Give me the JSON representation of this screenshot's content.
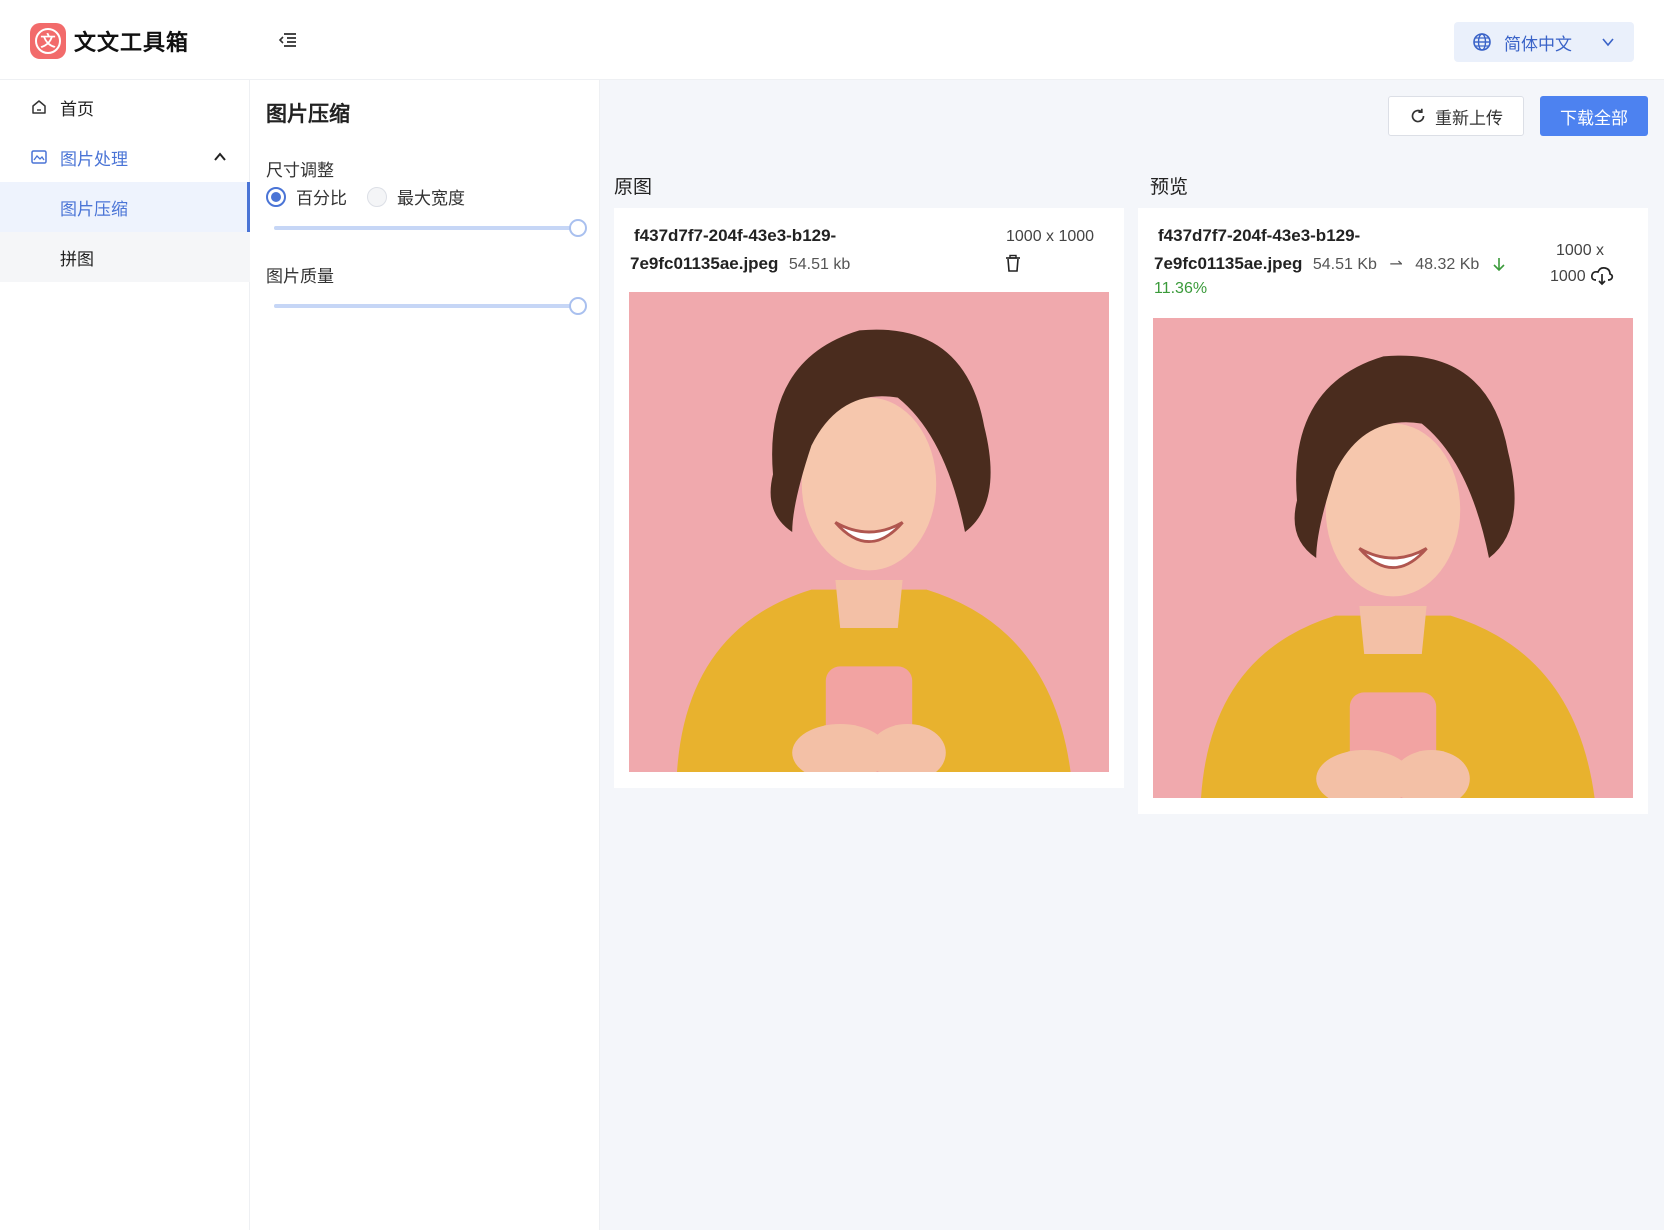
{
  "app": {
    "logo_glyph": "文",
    "name": "文文工具箱"
  },
  "header": {
    "language": "简体中文"
  },
  "sidebar": {
    "home": "首页",
    "group": "图片处理",
    "items": [
      {
        "label": "图片压缩",
        "active": true
      },
      {
        "label": "拼图",
        "active": false
      }
    ]
  },
  "settings": {
    "title": "图片压缩",
    "resize_label": "尺寸调整",
    "resize_options": [
      "百分比",
      "最大宽度"
    ],
    "resize_selected": "百分比",
    "resize_value": 1.0,
    "quality_label": "图片质量",
    "quality_value": 1.0
  },
  "toolbar": {
    "reupload": "重新上传",
    "download_all": "下载全部"
  },
  "original": {
    "label": "原图",
    "file_name_line1": "f437d7f7-204f-43e3-b129-",
    "file_name_line2": "7e9fc01135ae.jpeg",
    "size": "54.51 kb",
    "dimensions": "1000 x 1000"
  },
  "preview": {
    "label": "预览",
    "file_name_line1": "f437d7f7-204f-43e3-b129-",
    "file_name_line2": "7e9fc01135ae.jpeg",
    "size_before": "54.51 Kb",
    "arrow": "⇀",
    "size_after": "48.32 Kb",
    "reduction": "11.36%",
    "dim_line1": "1000 x",
    "dim_line2": "1000"
  },
  "colors": {
    "accent": "#4a74d6",
    "button": "#4d82f0",
    "logo": "#f26b6b",
    "success": "#3a9a3a",
    "photo_bg": "#f0a9ad",
    "shirt": "#e8b22e"
  }
}
